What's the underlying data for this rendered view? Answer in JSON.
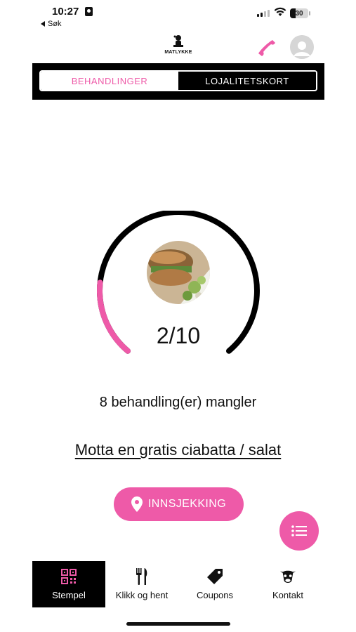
{
  "status_bar": {
    "time": "10:27",
    "back_label": "Søk",
    "battery": "30"
  },
  "header": {
    "logo_text": "MATLYKKE"
  },
  "tabs": [
    {
      "label": "BEHANDLINGER",
      "active": true
    },
    {
      "label": "LOJALITETSKORT",
      "active": false
    }
  ],
  "progress": {
    "count_text": "2/10",
    "current": 2,
    "total": 10
  },
  "remaining_text": "8 behandling(er) mangler",
  "reward_text": "Motta en gratis ciabatta / salat",
  "checkin_label": "INNSJEKKING",
  "bottom_nav": [
    {
      "label": "Stempel",
      "icon": "qr-code-icon",
      "active": true
    },
    {
      "label": "Klikk og hent",
      "icon": "fork-knife-icon",
      "active": false
    },
    {
      "label": "Coupons",
      "icon": "tag-icon",
      "active": false
    },
    {
      "label": "Kontakt",
      "icon": "cow-icon",
      "active": false
    }
  ],
  "colors": {
    "accent": "#ee5aa8",
    "dark": "#000000"
  }
}
